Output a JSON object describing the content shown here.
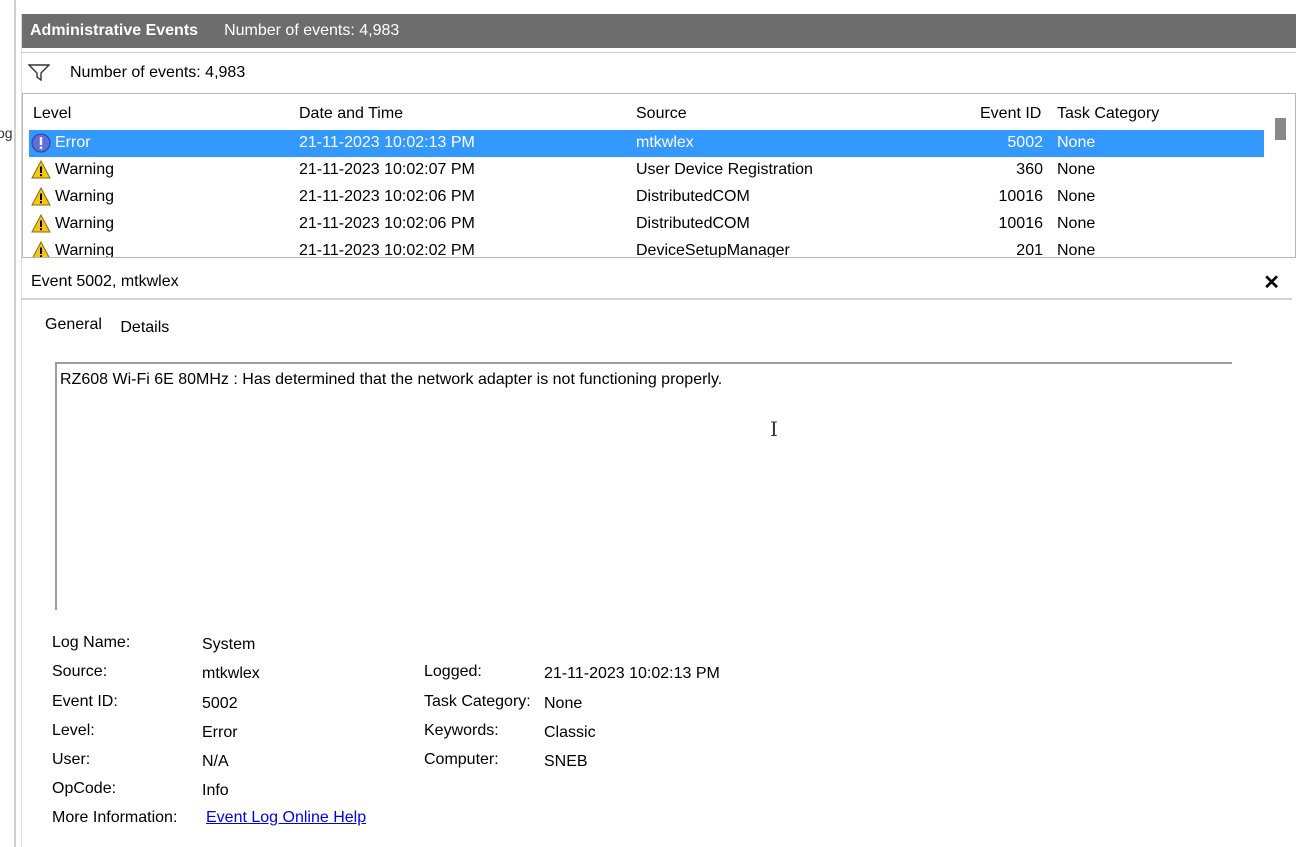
{
  "left_clip": {
    "text": "og"
  },
  "header": {
    "title": "Administrative Events",
    "count": "Number of events: 4,983"
  },
  "filter": {
    "icon": "filter-icon",
    "count": "Number of events: 4,983"
  },
  "grid": {
    "columns": [
      "Level",
      "Date and Time",
      "Source",
      "Event ID",
      "Task Category"
    ],
    "rows": [
      {
        "level": "Error",
        "icon": "error-icon",
        "datetime": "21-11-2023 10:02:13 PM",
        "source": "mtkwlex",
        "event_id": "5002",
        "category": "None",
        "selected": true
      },
      {
        "level": "Warning",
        "icon": "warning-icon",
        "datetime": "21-11-2023 10:02:07 PM",
        "source": "User Device Registration",
        "event_id": "360",
        "category": "None"
      },
      {
        "level": "Warning",
        "icon": "warning-icon",
        "datetime": "21-11-2023 10:02:06 PM",
        "source": "DistributedCOM",
        "event_id": "10016",
        "category": "None"
      },
      {
        "level": "Warning",
        "icon": "warning-icon",
        "datetime": "21-11-2023 10:02:06 PM",
        "source": "DistributedCOM",
        "event_id": "10016",
        "category": "None"
      },
      {
        "level": "Warning",
        "icon": "warning-icon",
        "datetime": "21-11-2023 10:02:02 PM",
        "source": "DeviceSetupManager",
        "event_id": "201",
        "category": "None"
      }
    ]
  },
  "detail": {
    "title": "Event 5002, mtkwlex",
    "close_glyph": "✕",
    "tabs": [
      "General",
      "Details"
    ],
    "description": "RZ608 Wi-Fi 6E 80MHz : Has determined that the network adapter is not functioning properly.",
    "properties": {
      "log_name_label": "Log Name:",
      "log_name": "System",
      "source_label": "Source:",
      "source": "mtkwlex",
      "logged_label": "Logged:",
      "logged": "21-11-2023 10:02:13 PM",
      "event_id_label": "Event ID:",
      "event_id": "5002",
      "task_category_label": "Task Category:",
      "task_category": "None",
      "level_label": "Level:",
      "level": "Error",
      "keywords_label": "Keywords:",
      "keywords": "Classic",
      "user_label": "User:",
      "user": "N/A",
      "computer_label": "Computer:",
      "computer": "SNEB",
      "opcode_label": "OpCode:",
      "opcode": "Info",
      "more_info_label": "More Information:",
      "more_info_link": "Event Log Online Help"
    }
  }
}
